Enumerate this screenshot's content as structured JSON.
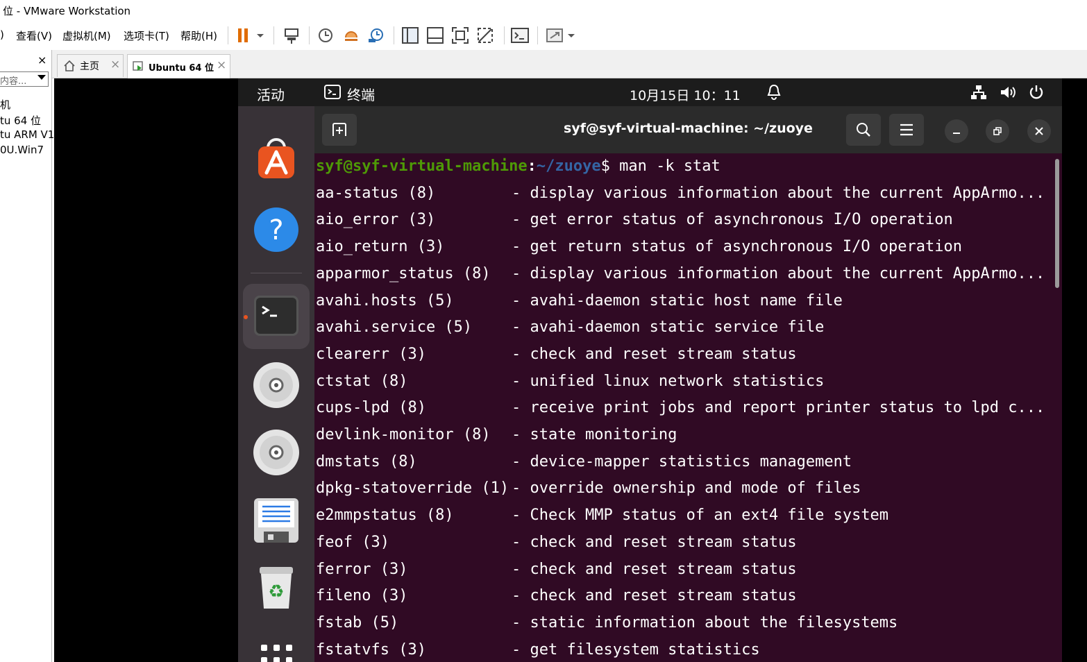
{
  "window": {
    "title": "位 - VMware Workstation"
  },
  "menubar": {
    "items": [
      {
        "label": ")"
      },
      {
        "label": "查看(V)"
      },
      {
        "label": "虚拟机(M)"
      },
      {
        "label": "选项卡(T)"
      },
      {
        "label": "帮助(H)"
      }
    ]
  },
  "library": {
    "search_placeholder": "内容...",
    "items": [
      "机",
      "tu 64 位",
      "tu ARM V1",
      "0U.Win7"
    ]
  },
  "tabs": [
    {
      "label": "主页",
      "active": false
    },
    {
      "label": "Ubuntu 64 位",
      "active": true
    }
  ],
  "ubuntu": {
    "topbar": {
      "activities": "活动",
      "app_name": "终端",
      "datetime": "10月15日  10：11"
    },
    "terminal": {
      "title": "syf@syf-virtual-machine: ~/zuoye",
      "prompt_user": "syf@syf-virtual-machine",
      "prompt_sep": ":",
      "prompt_path": "~/zuoye",
      "prompt_tail": "$ man -k stat",
      "lines": [
        {
          "cmd": "aa-status (8)",
          "desc": "- display various information about the current AppArmo..."
        },
        {
          "cmd": "aio_error (3)",
          "desc": "- get error status of asynchronous I/O operation"
        },
        {
          "cmd": "aio_return (3)",
          "desc": "- get return status of asynchronous I/O operation"
        },
        {
          "cmd": "apparmor_status (8)",
          "desc": "- display various information about the current AppArmo..."
        },
        {
          "cmd": "avahi.hosts (5)",
          "desc": "- avahi-daemon static host name file"
        },
        {
          "cmd": "avahi.service (5)",
          "desc": "- avahi-daemon static service file"
        },
        {
          "cmd": "clearerr (3)",
          "desc": "- check and reset stream status"
        },
        {
          "cmd": "ctstat (8)",
          "desc": "- unified linux network statistics"
        },
        {
          "cmd": "cups-lpd (8)",
          "desc": "- receive print jobs and report printer status to lpd c..."
        },
        {
          "cmd": "devlink-monitor (8)",
          "desc": "- state monitoring"
        },
        {
          "cmd": "dmstats (8)",
          "desc": "- device-mapper statistics management"
        },
        {
          "cmd": "dpkg-statoverride (1)",
          "desc": "- override ownership and mode of files"
        },
        {
          "cmd": "e2mmpstatus (8)",
          "desc": "- Check MMP status of an ext4 file system"
        },
        {
          "cmd": "feof (3)",
          "desc": "- check and reset stream status"
        },
        {
          "cmd": "ferror (3)",
          "desc": "- check and reset stream status"
        },
        {
          "cmd": "fileno (3)",
          "desc": "- check and reset stream status"
        },
        {
          "cmd": "fstab (5)",
          "desc": "- static information about the filesystems"
        },
        {
          "cmd": "fstatvfs (3)",
          "desc": "- get filesystem statistics"
        }
      ]
    },
    "dock_icons": [
      "software-center-icon",
      "help-icon",
      "terminal-icon",
      "disc-icon",
      "disc-icon",
      "text-editor-icon",
      "trash-icon",
      "app-grid-icon"
    ]
  },
  "colors": {
    "terminal_bg": "#300a24",
    "prompt_user": "#4e9a06",
    "prompt_path": "#3465a4",
    "dock_bg": "#383237",
    "topbar_bg": "#1c1c1c"
  }
}
